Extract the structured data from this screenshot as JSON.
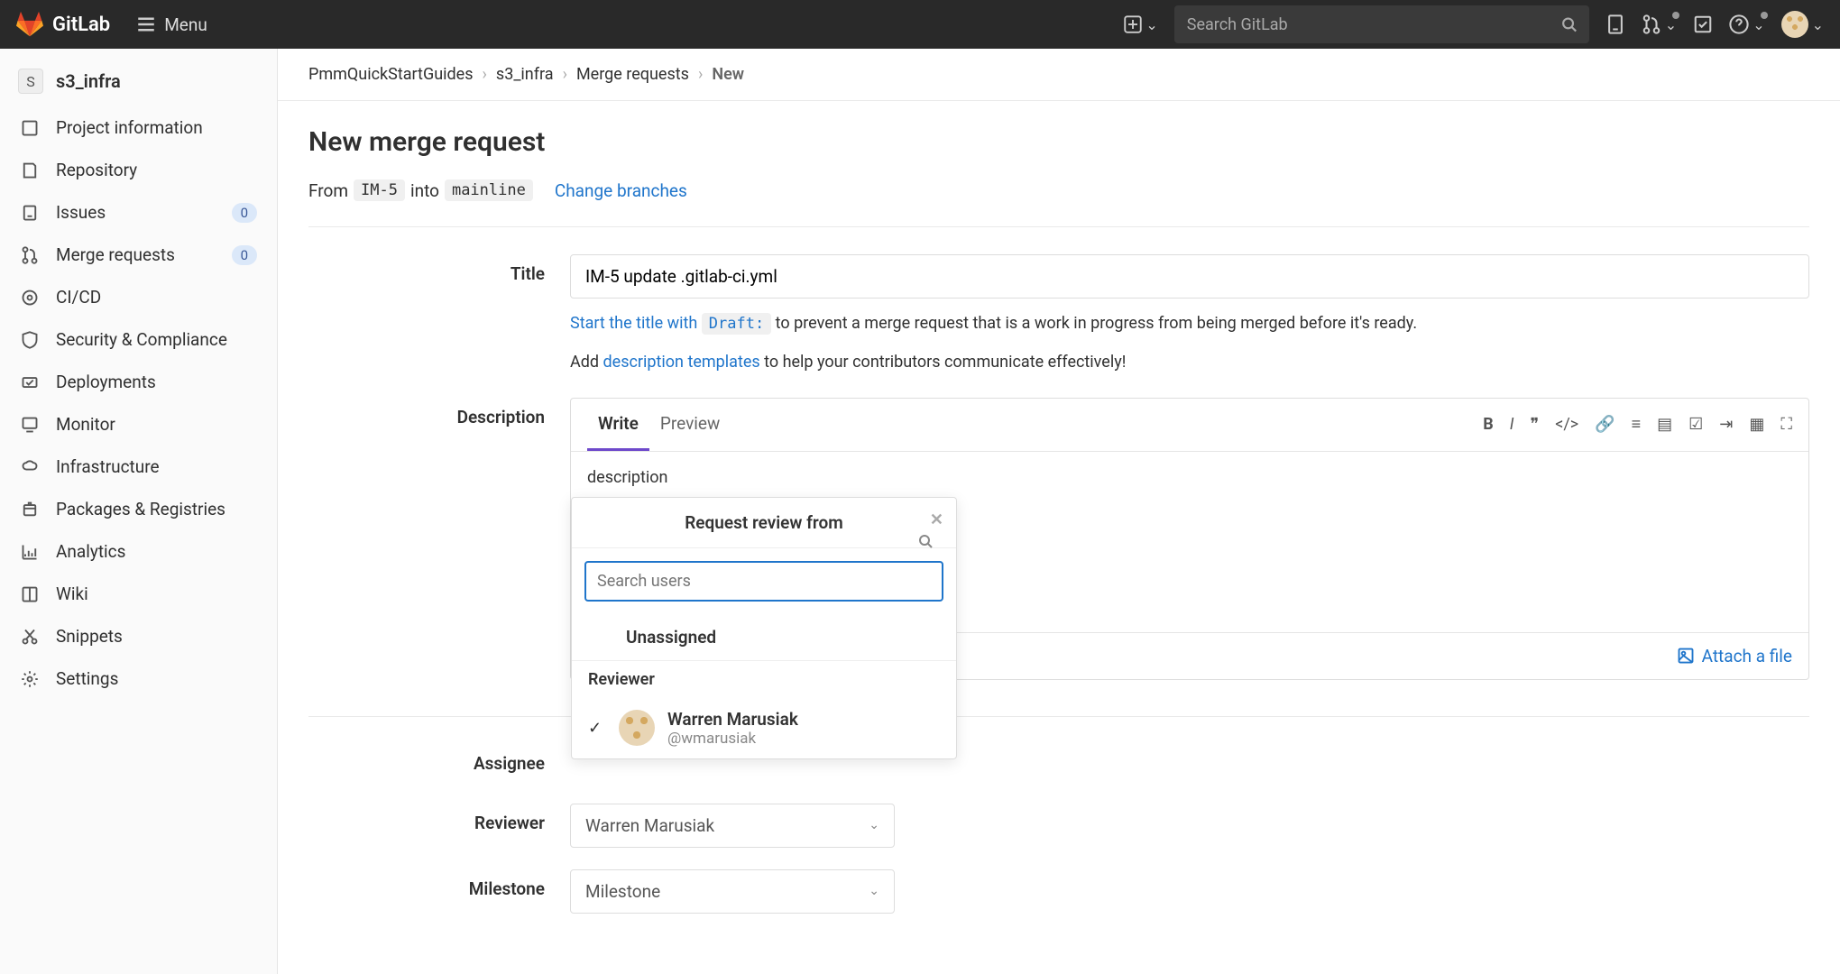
{
  "topbar": {
    "brand": "GitLab",
    "menu": "Menu",
    "search_placeholder": "Search GitLab"
  },
  "sidebar": {
    "project_initial": "S",
    "project_name": "s3_infra",
    "items": [
      {
        "label": "Project information"
      },
      {
        "label": "Repository"
      },
      {
        "label": "Issues",
        "badge": "0"
      },
      {
        "label": "Merge requests",
        "badge": "0"
      },
      {
        "label": "CI/CD"
      },
      {
        "label": "Security & Compliance"
      },
      {
        "label": "Deployments"
      },
      {
        "label": "Monitor"
      },
      {
        "label": "Infrastructure"
      },
      {
        "label": "Packages & Registries"
      },
      {
        "label": "Analytics"
      },
      {
        "label": "Wiki"
      },
      {
        "label": "Snippets"
      },
      {
        "label": "Settings"
      }
    ]
  },
  "breadcrumb": {
    "a": "PmmQuickStartGuides",
    "b": "s3_infra",
    "c": "Merge requests",
    "d": "New"
  },
  "page": {
    "title": "New merge request",
    "from_label": "From",
    "from_branch": "IM-5",
    "into_label": "into",
    "to_branch": "mainline",
    "change_branches": "Change branches"
  },
  "form": {
    "title_label": "Title",
    "title_value": "IM-5 update .gitlab-ci.yml",
    "draft_prefix": "Start the title with ",
    "draft_code": "Draft:",
    "draft_suffix": " to prevent a merge request that is a work in progress from being merged before it's ready.",
    "add_label": "Add ",
    "template_link": "description templates",
    "template_suffix": " to help your contributors communicate effectively!",
    "description_label": "Description",
    "write_tab": "Write",
    "preview_tab": "Preview",
    "description_value": "description",
    "attach": "Attach a file",
    "assignee_label": "Assignee",
    "reviewer_label": "Reviewer",
    "reviewer_value": "Warren Marusiak",
    "milestone_label": "Milestone",
    "milestone_value": "Milestone"
  },
  "dropdown": {
    "title": "Request review from",
    "search_placeholder": "Search users",
    "unassigned": "Unassigned",
    "section": "Reviewer",
    "user_name": "Warren Marusiak",
    "user_handle": "@wmarusiak"
  }
}
